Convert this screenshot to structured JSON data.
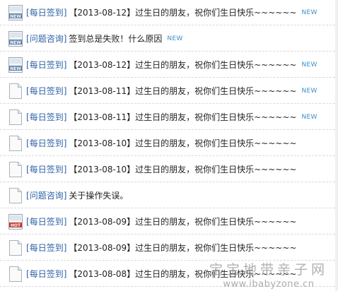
{
  "threads": [
    {
      "icon": "new-icon",
      "category": "每日签到",
      "title": "【2013-08-12】过生日的朋友，祝你们生日快乐~~~~~~",
      "badge": "NEW"
    },
    {
      "icon": "new-icon",
      "category": "问题咨询",
      "title": "签到总是失败！什么原因",
      "badge": "NEW"
    },
    {
      "icon": "new-icon",
      "category": "每日签到",
      "title": "【2013-08-12】过生日的朋友，祝你们生日快乐~~~~~~",
      "badge": "NEW"
    },
    {
      "icon": "page-icon",
      "category": "每日签到",
      "title": "【2013-08-11】过生日的朋友，祝你们生日快乐~~~~~~",
      "badge": "NEW"
    },
    {
      "icon": "page-icon",
      "category": "每日签到",
      "title": "【2013-08-11】过生日的朋友，祝你们生日快乐~~~~~~",
      "badge": "NEW"
    },
    {
      "icon": "page-icon",
      "category": "每日签到",
      "title": "【2013-08-10】过生日的朋友，祝你们生日快乐~~~~~~",
      "badge": ""
    },
    {
      "icon": "page-icon",
      "category": "每日签到",
      "title": "【2013-08-10】过生日的朋友，祝你们生日快乐~~~~~~",
      "badge": ""
    },
    {
      "icon": "page-icon",
      "category": "问题咨询",
      "title": "关于操作失误。",
      "badge": ""
    },
    {
      "icon": "hot-icon",
      "category": "每日签到",
      "title": "【2013-08-09】过生日的朋友，祝你们生日快乐~~~~~~",
      "badge": ""
    },
    {
      "icon": "page-icon",
      "category": "每日签到",
      "title": "【2013-08-09】过生日的朋友，祝你们生日快乐~~~~~~",
      "badge": ""
    },
    {
      "icon": "page-icon",
      "category": "每日签到",
      "title": "【2013-08-08】过生日的朋友，祝你们生日快乐~~~~~~",
      "badge": ""
    }
  ],
  "watermark": {
    "line1": "宝宝地带亲子网",
    "line2": "www.ibabyzone.cn"
  },
  "colors": {
    "category_link": "#2e62a8",
    "new_badge": "#3d8fc7",
    "hot_icon": "#c0392b"
  }
}
